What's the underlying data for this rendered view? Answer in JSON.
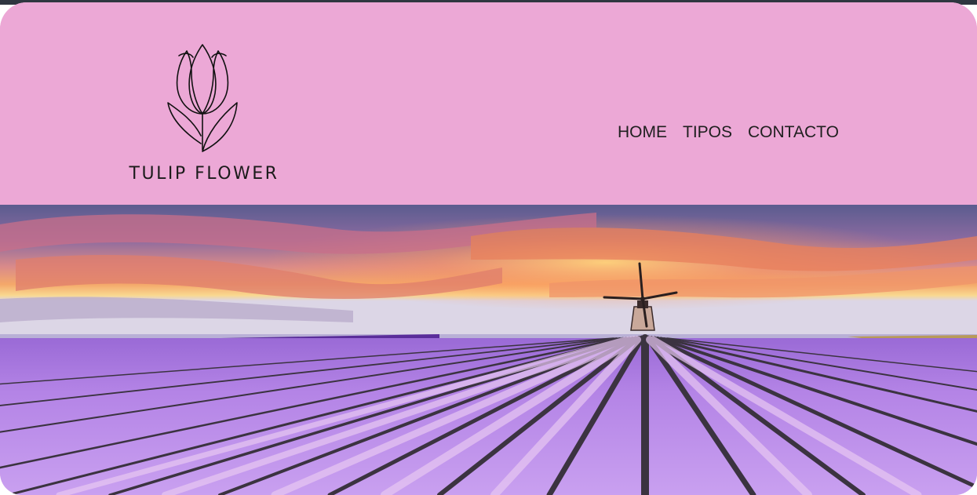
{
  "brand": {
    "name": "TULIP FLOWER",
    "icon": "tulip-outline-icon"
  },
  "nav": {
    "items": [
      {
        "label": "HOME"
      },
      {
        "label": "TIPOS"
      },
      {
        "label": "CONTACTO"
      }
    ]
  },
  "hero": {
    "image": "tulip-field-windmill-sunset"
  },
  "colors": {
    "header_bg": "#eca8d6",
    "text": "#1f1f1f",
    "top_strip": "#2f3640"
  }
}
